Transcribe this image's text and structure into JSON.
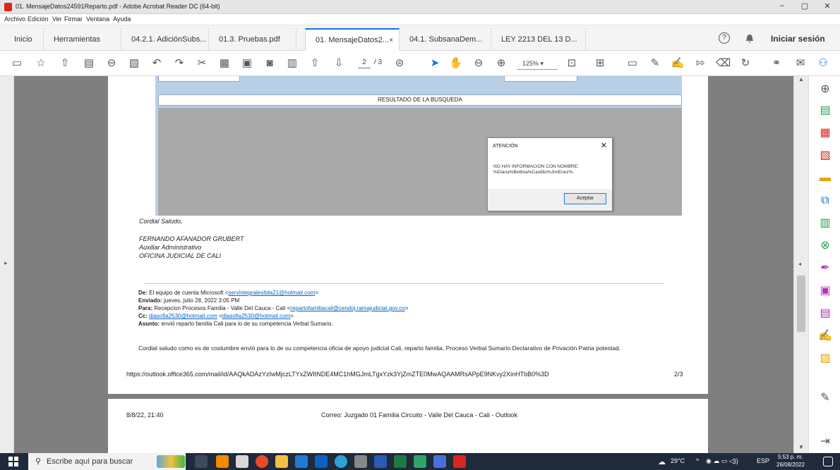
{
  "window": {
    "title": "01. MensajeDatos24591Reparto.pdf - Adobe Acrobat Reader DC (64-bit)",
    "controls": {
      "minimize": "–",
      "maximize": "▢",
      "close": "✕"
    }
  },
  "menu": [
    "Archivo",
    "Edición",
    "Ver",
    "Firmar",
    "Ventana",
    "Ayuda"
  ],
  "tabs": {
    "home": "Inicio",
    "tools": "Herramientas",
    "docs": [
      "04.2.1. AdiciónSubs...",
      "01.3. Pruebas.pdf",
      "01. MensajeDatos2...",
      "04.1. SubsanaDem...",
      "LEY 2213 DEL 13 D..."
    ],
    "active_index": 2,
    "close_glyph": "×",
    "help_glyph": "?",
    "signin": "Iniciar sesión"
  },
  "toolbar": {
    "page_current": "2",
    "page_total": "/ 3",
    "zoom": "125%",
    "zoom_caret": "▾"
  },
  "document": {
    "result_header": "RESULTADO DE LA BUSQUEDA",
    "dialog": {
      "title": "ATENCIÓN",
      "close": "✕",
      "message": "NO HAY INFORMACION CON NOMBRE: %Diana%Bettina%Castillo%JimEnez%.",
      "button": "Aceptar"
    },
    "greeting": "Cordial Saludo,",
    "signature": [
      "FERNANDO AFANADOR GRUBERT",
      "Auxiliar Administrativo",
      "OFICINA JUDICIAL DE CALI"
    ],
    "email": {
      "from_label": "De:",
      "from_value": "El equipo de cuenta Microsoft <",
      "from_link": "servintegralesltda21@hotmail.com",
      "from_end": ">",
      "sent_label": "Enviado:",
      "sent_value": "jueves, julio 28, 2022 3:05 PM",
      "to_label": "Para:",
      "to_value": "Recepcion Procesos Familia - Valle Del Cauca - Cali <",
      "to_link": "repartofamiliacali@cendoj.ramajudicial.gov.co",
      "to_end": ">",
      "cc_label": "Cc:",
      "cc_link1": "diasofia2530@hotmail.com",
      "cc_mid": "<",
      "cc_link2": "diasofia2530@hotmail.com",
      "cc_end": ">",
      "subject_label": "Asunto:",
      "subject_value": "envió reparto familia Cali para lo de su competencia Verbal Sumario."
    },
    "body": "Cordial saludo como es de costumbre envió para lo de su competencia  oficia de apoyo judicial Cali, reparto familia, Proceso Verbal Sumario Declarativo de Privación Patria potestad.",
    "url": "https://outlook.office365.com/mail/id/AAQkADAzYzIwMjczLTYxZWItNDE4MC1hMGJmLTgxYzk3YjZmZTE0MwAQAAMRsAPpE9NKvy2XinHTbB0%3D",
    "page_indicator": "2/3",
    "page2_date": "8/8/22, 21:40",
    "page2_header": "Correo: Juzgado 01 Familia Circuito - Valle Del Cauca - Cali - Outlook"
  },
  "taskbar": {
    "search_placeholder": "Escribe aquí para buscar",
    "weather": "29°C",
    "lang": "ESP",
    "time": "5:53 p. m.",
    "date": "26/08/2022"
  },
  "colors": {
    "titlebar": "#e5e5e5",
    "accent": "#1473e6",
    "acrobat_red": "#d9261c",
    "viewer_bg": "#7f7f7f",
    "form_blue": "#b9cfe6",
    "taskbar": "#1f2a3a"
  }
}
